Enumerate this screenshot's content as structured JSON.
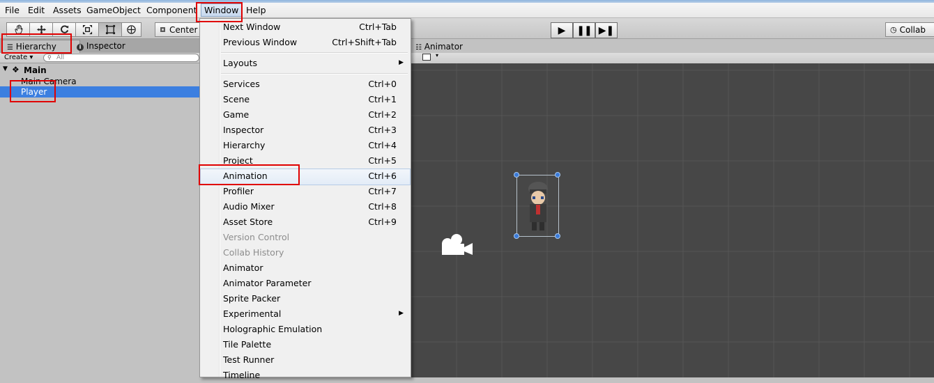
{
  "menubar": {
    "items": [
      "File",
      "Edit",
      "Assets",
      "GameObject",
      "Component",
      "Window",
      "Help"
    ]
  },
  "toolbar": {
    "pivot_label": "Center",
    "collab_label": "Collab",
    "tools": [
      "hand-icon",
      "move-icon",
      "rotate-icon",
      "scale-icon",
      "rect-icon",
      "transform-icon"
    ]
  },
  "panels": {
    "hierarchy_tab": "Hierarchy",
    "inspector_tab": "Inspector",
    "animator_tab": "Animator",
    "create_label": "Create",
    "search_placeholder": "All"
  },
  "hierarchy": {
    "scene_name": "Main",
    "items": [
      "Main Camera",
      "Player"
    ],
    "selected": "Player"
  },
  "window_menu": {
    "groups": [
      [
        {
          "label": "Next Window",
          "shortcut": "Ctrl+Tab"
        },
        {
          "label": "Previous Window",
          "shortcut": "Ctrl+Shift+Tab"
        }
      ],
      [
        {
          "label": "Layouts",
          "shortcut": "",
          "submenu": true
        }
      ],
      [
        {
          "label": "Services",
          "shortcut": "Ctrl+0"
        },
        {
          "label": "Scene",
          "shortcut": "Ctrl+1"
        },
        {
          "label": "Game",
          "shortcut": "Ctrl+2"
        },
        {
          "label": "Inspector",
          "shortcut": "Ctrl+3"
        },
        {
          "label": "Hierarchy",
          "shortcut": "Ctrl+4"
        },
        {
          "label": "Project",
          "shortcut": "Ctrl+5"
        },
        {
          "label": "Animation",
          "shortcut": "Ctrl+6",
          "highlighted": true
        },
        {
          "label": "Profiler",
          "shortcut": "Ctrl+7"
        },
        {
          "label": "Audio Mixer",
          "shortcut": "Ctrl+8"
        },
        {
          "label": "Asset Store",
          "shortcut": "Ctrl+9"
        },
        {
          "label": "Version Control",
          "shortcut": "",
          "disabled": true
        },
        {
          "label": "Collab History",
          "shortcut": "",
          "disabled": true
        },
        {
          "label": "Animator",
          "shortcut": ""
        },
        {
          "label": "Animator Parameter",
          "shortcut": ""
        },
        {
          "label": "Sprite Packer",
          "shortcut": ""
        },
        {
          "label": "Experimental",
          "shortcut": "",
          "submenu": true
        },
        {
          "label": "Holographic Emulation",
          "shortcut": ""
        },
        {
          "label": "Tile Palette",
          "shortcut": ""
        },
        {
          "label": "Test Runner",
          "shortcut": ""
        },
        {
          "label": "Timeline",
          "shortcut": ""
        }
      ]
    ]
  },
  "colors": {
    "highlight_box": "#e00000",
    "selection_blue": "#3c7fe0",
    "scene_bg": "#474747"
  }
}
